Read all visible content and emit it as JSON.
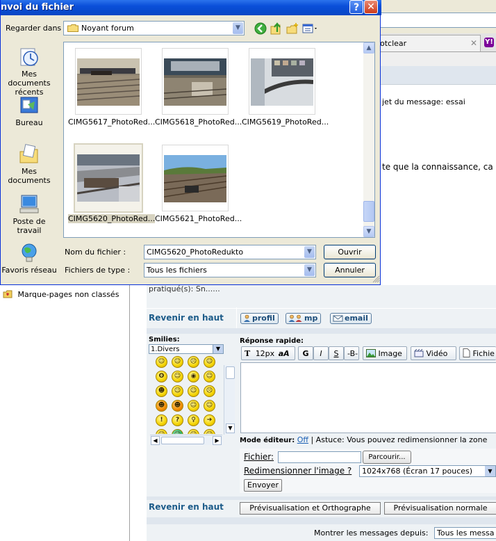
{
  "dialog": {
    "title": "nvoi du fichier",
    "help_label": "?",
    "close_label": "✕",
    "look_in_label": "Regarder dans :",
    "look_in_value": "Noyant forum",
    "places": [
      {
        "label": "Mes documents récents",
        "icon": "recent-documents-icon"
      },
      {
        "label": "Bureau",
        "icon": "desktop-icon"
      },
      {
        "label": "Mes documents",
        "icon": "my-documents-icon"
      },
      {
        "label": "Poste de travail",
        "icon": "my-computer-icon"
      },
      {
        "label": "Favoris réseau",
        "icon": "network-places-icon"
      }
    ],
    "files": [
      {
        "name": "CIMG5617_PhotoRed...",
        "selected": false
      },
      {
        "name": "CIMG5618_PhotoRed...",
        "selected": false
      },
      {
        "name": "CIMG5619_PhotoRed...",
        "selected": false
      },
      {
        "name": "CIMG5620_PhotoRed...",
        "selected": true
      },
      {
        "name": "CIMG5621_PhotoRed...",
        "selected": false
      }
    ],
    "file_name_label": "Nom du fichier :",
    "file_name_value": "CIMG5620_PhotoRedukto",
    "file_type_label": "Fichiers de type :",
    "file_type_value": "Tous les fichiers",
    "open_label": "Ouvrir",
    "cancel_label": "Annuler"
  },
  "browser": {
    "tab_label": "otclear",
    "tab_close": "✕",
    "yahoo_badge": "Y!"
  },
  "sidebar": {
    "bookmark_label": "Marque-pages non classés"
  },
  "forum": {
    "subject_fragment": "jet du message: essai",
    "body_fragment": "te que la connaissance, ca",
    "pratique_fragment": "pratiqué(s): Sn......",
    "back_to_top": "Revenir en haut",
    "profile_buttons": {
      "profil": "profil",
      "mp": "mp",
      "email": "email"
    },
    "smilies_label": "Smilies:",
    "smilies_select": "1.Divers",
    "quick_reply_label": "Réponse rapide:",
    "toolbar": {
      "font_size": "12px",
      "bold": "G",
      "italic": "I",
      "underline": "S",
      "strike": "-B-",
      "image": "Image",
      "video": "Vidéo",
      "file": "Fichie"
    },
    "editor_mode_label": "Mode éditeur:",
    "editor_mode_value": "Off",
    "editor_tip": "| Astuce: Vous pouvez redimensionner la zone",
    "file_label": "Fichier:",
    "browse_label": "Parcourir...",
    "resize_label": "Redimensionner l'image ?",
    "resize_value": "1024x768 (Écran 17 pouces)",
    "send_label": "Envoyer",
    "preview_spelling": "Prévisualisation et Orthographe",
    "preview_normal": "Prévisualisation normale",
    "show_messages_label": "Montrer les messages depuis:",
    "show_messages_value": "Tous les messa"
  },
  "colors": {
    "xp_title_blue": "#0a4fd9",
    "dialog_face": "#ece9d8",
    "forum_link": "#1d5c8a",
    "forum_bg": "#eef2f5"
  }
}
